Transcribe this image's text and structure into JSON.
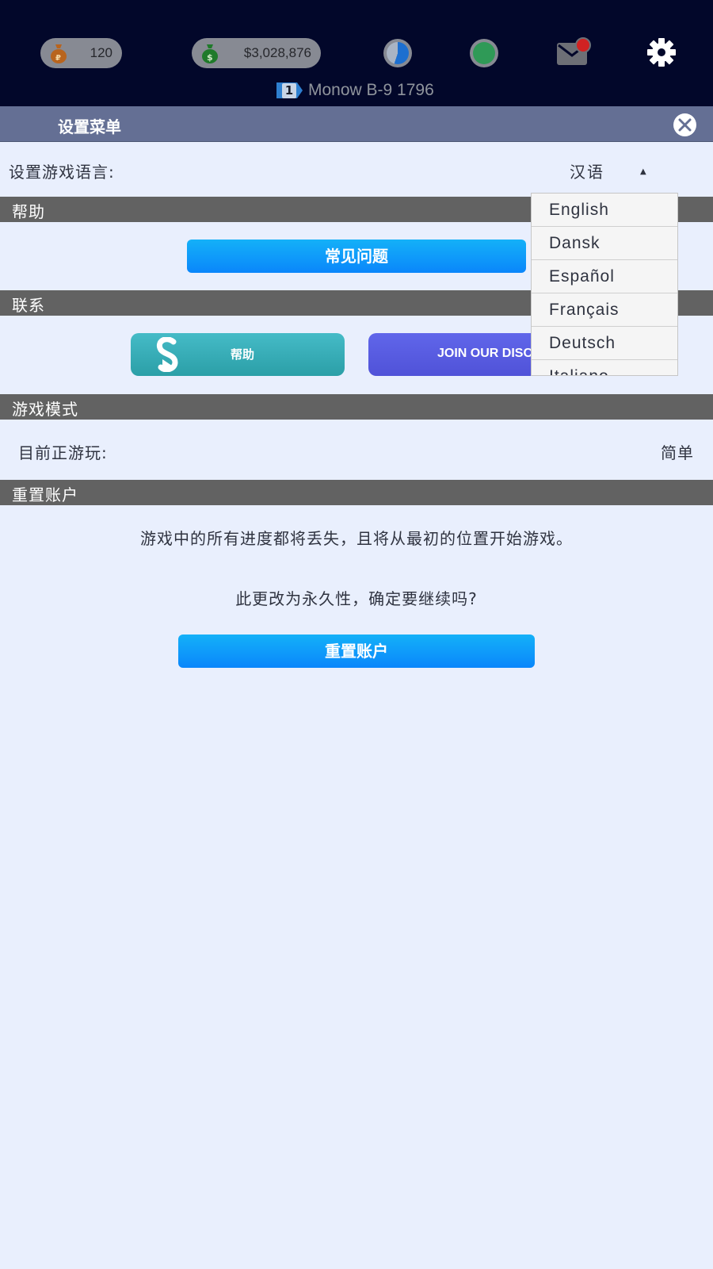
{
  "topbar": {
    "rp_value": "120",
    "cash_value": "$3,028,876",
    "level": "1",
    "player_name": "Monow B-9 1796",
    "icons": [
      "rp-bag-icon",
      "money-bag-icon",
      "clock-icon",
      "status-dot-icon",
      "mail-icon",
      "gear-icon"
    ]
  },
  "settings": {
    "title": "设置菜单",
    "language_label": "设置游戏语言:",
    "language_selected": "汉语",
    "language_options": [
      "English",
      "Dansk",
      "Español",
      "Français",
      "Deutsch",
      "Italiano"
    ]
  },
  "help": {
    "section_title": "帮助",
    "faq_button": "常见问题"
  },
  "contact": {
    "section_title": "联系",
    "help_button": "帮助",
    "discord_button": "JOIN OUR DISCORD"
  },
  "game_mode": {
    "section_title": "游戏模式",
    "current_label": "目前正游玩:",
    "current_value": "简单"
  },
  "reset": {
    "section_title": "重置账户",
    "warning_line1": "游戏中的所有进度都将丢失，且将从最初的位置开始游戏。",
    "warning_line2": "此更改为永久性，确定要继续吗?",
    "reset_button": "重置账户"
  },
  "colors": {
    "topbar_bg": "#02072a",
    "header_bg": "#646f94",
    "section_bg": "#626262",
    "page_bg": "#e9effd",
    "button_blue": "#0a86fb",
    "help_teal": "#2b9fa7",
    "discord_purple": "#5052d8"
  }
}
